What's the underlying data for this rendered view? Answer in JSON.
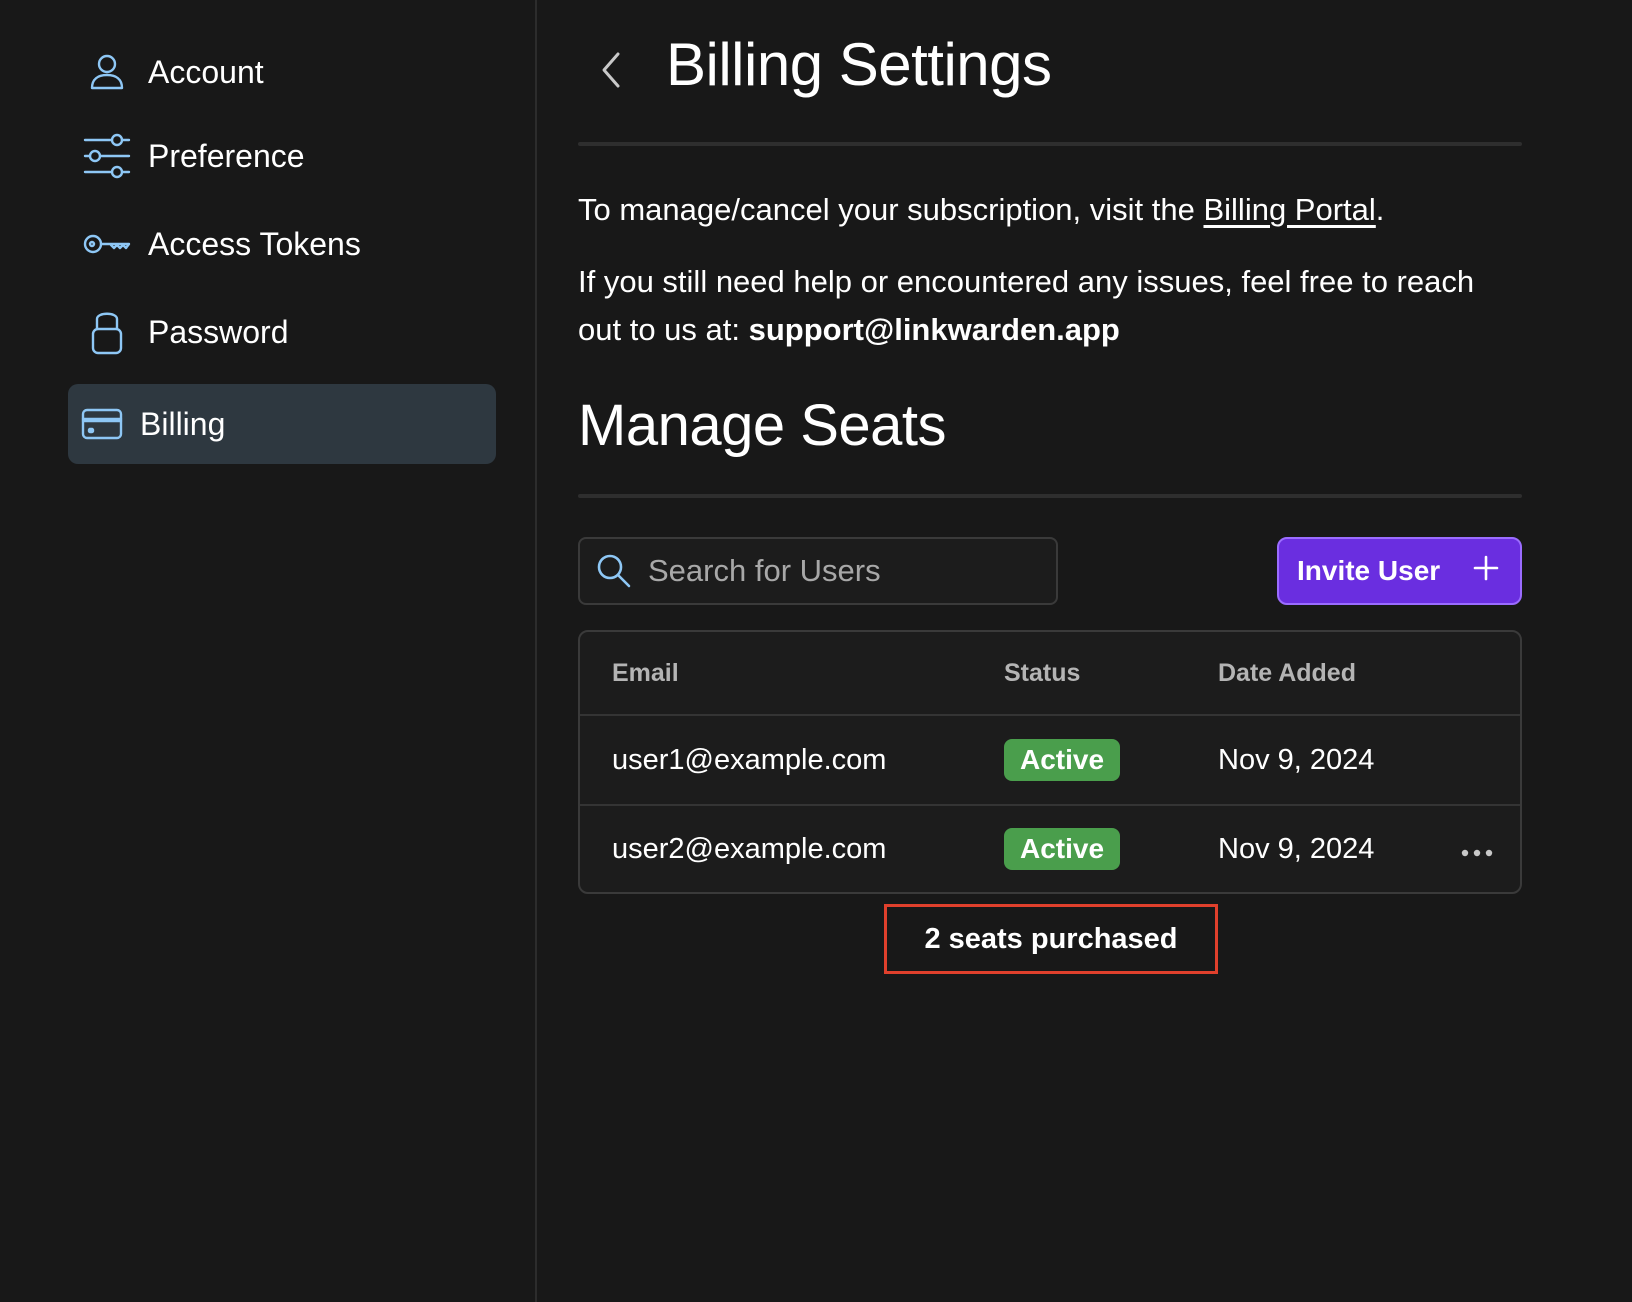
{
  "sidebar": {
    "items": [
      {
        "label": "Account",
        "icon": "user-icon"
      },
      {
        "label": "Preference",
        "icon": "sliders-icon"
      },
      {
        "label": "Access Tokens",
        "icon": "key-icon"
      },
      {
        "label": "Password",
        "icon": "lock-icon"
      },
      {
        "label": "Billing",
        "icon": "credit-card-icon",
        "active": true
      }
    ]
  },
  "header": {
    "title": "Billing Settings"
  },
  "billing": {
    "manage_text": "To manage/cancel your subscription, visit the ",
    "portal_link": "Billing Portal",
    "manage_suffix": ".",
    "help_text": "If you still need help or encountered any issues, feel free to reach out to us at: ",
    "support_email": "support@linkwarden.app"
  },
  "seats": {
    "title": "Manage Seats",
    "search_placeholder": "Search for Users",
    "invite_label": "Invite User",
    "columns": [
      "Email",
      "Status",
      "Date Added"
    ],
    "rows": [
      {
        "email": "user1@example.com",
        "status": "Active",
        "date": "Nov 9, 2024"
      },
      {
        "email": "user2@example.com",
        "status": "Active",
        "date": "Nov 9, 2024"
      }
    ],
    "purchased_text": "2 seats purchased"
  },
  "colors": {
    "background": "#181818",
    "accent": "#6a2ee0",
    "active_badge": "#4a9e4c",
    "icon": "#8ec7f5",
    "highlight_border": "#e0402c"
  }
}
